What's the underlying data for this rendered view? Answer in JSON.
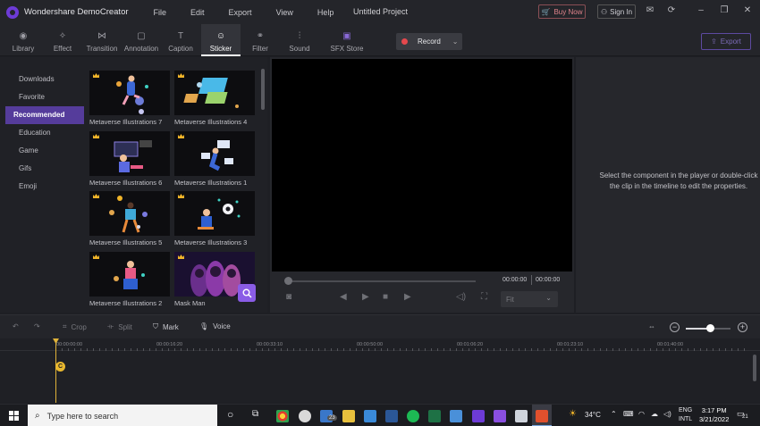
{
  "app": {
    "name": "Wondershare DemoCreator",
    "project_title": "Untitled Project",
    "menu": [
      "File",
      "Edit",
      "Export",
      "View",
      "Help"
    ],
    "buy_now": "Buy Now",
    "sign_in": "Sign In"
  },
  "toolbar": {
    "tabs": [
      {
        "label": "Library",
        "icon": "library-icon"
      },
      {
        "label": "Effect",
        "icon": "effect-icon"
      },
      {
        "label": "Transition",
        "icon": "transition-icon"
      },
      {
        "label": "Annotation",
        "icon": "annotation-icon"
      },
      {
        "label": "Caption",
        "icon": "caption-icon"
      },
      {
        "label": "Sticker",
        "icon": "sticker-icon",
        "active": true
      },
      {
        "label": "Filter",
        "icon": "filter-icon"
      },
      {
        "label": "Sound",
        "icon": "sound-icon"
      },
      {
        "label": "SFX Store",
        "icon": "sfx-store-icon"
      }
    ],
    "record_label": "Record",
    "export_label": "Export"
  },
  "categories": {
    "items": [
      "Downloads",
      "Favorite",
      "Recommended",
      "Education",
      "Game",
      "Gifs",
      "Emoji"
    ],
    "active": "Recommended"
  },
  "stickers": [
    {
      "label": "Metaverse Illustrations 7",
      "premium": true
    },
    {
      "label": "Metaverse Illustrations 4",
      "premium": true
    },
    {
      "label": "Metaverse Illustrations 6",
      "premium": true
    },
    {
      "label": "Metaverse Illustrations 1",
      "premium": true
    },
    {
      "label": "Metaverse Illustrations 5",
      "premium": true
    },
    {
      "label": "Metaverse Illustrations 3",
      "premium": true
    },
    {
      "label": "Metaverse Illustrations 2",
      "premium": true
    },
    {
      "label": "Mask Man",
      "premium": true
    }
  ],
  "player": {
    "current_time": "00:00:00",
    "total_time": "00:00:00",
    "fit_label": "Fit"
  },
  "properties": {
    "message": "Select the component in the player or double-click the clip in the timeline to edit the properties."
  },
  "timeline_tools": {
    "crop": "Crop",
    "split": "Split",
    "mark": "Mark",
    "voice": "Voice"
  },
  "timeline": {
    "ruler_labels": [
      "00:00:00:00",
      "00:00:16:20",
      "00:00:33:10",
      "00:00:50:00",
      "00:01:06:20",
      "00:01:23:10",
      "00:01:40:00"
    ],
    "marker_label": "C"
  },
  "taskbar": {
    "search_placeholder": "Type here to search",
    "weather": "34°C",
    "lang_line1": "ENG",
    "lang_line2": "INTL",
    "time": "3:17 PM",
    "date": "3/21/2022",
    "notifications": "21",
    "badge": "23"
  },
  "colors": {
    "accent": "#553c9b",
    "record": "#e5484d",
    "crown": "#f0b429",
    "playhead": "#e0b33a"
  }
}
